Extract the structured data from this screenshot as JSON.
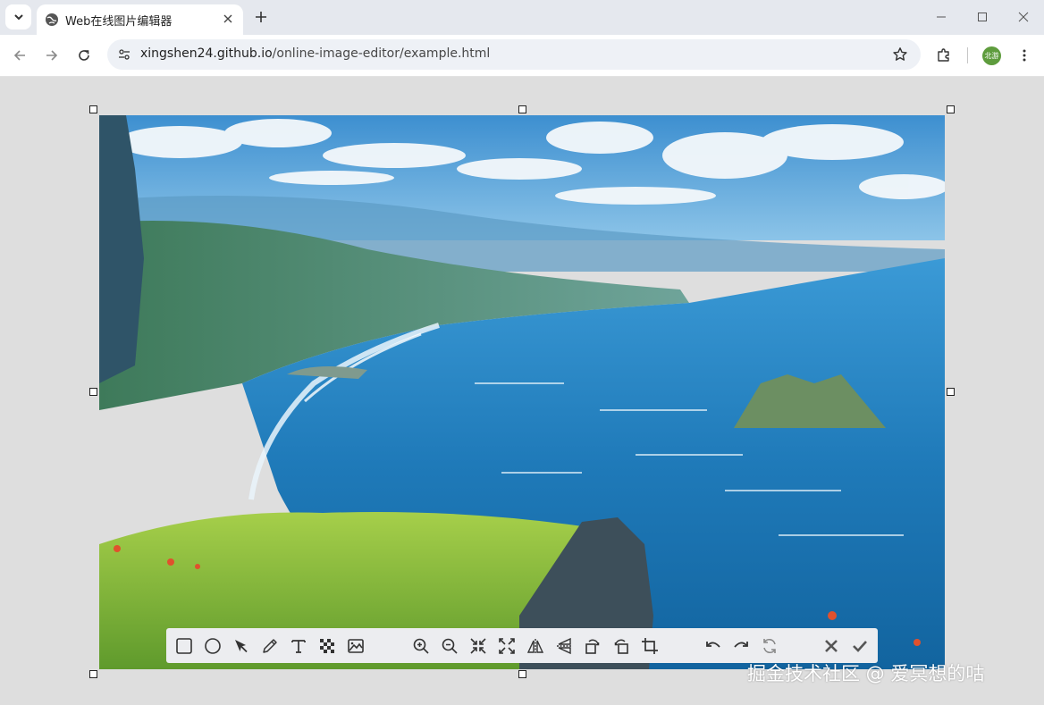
{
  "browser": {
    "tab_title": "Web在线图片编辑器",
    "url_host": "xingshen24.github.io",
    "url_path": "/online-image-editor/example.html",
    "profile_label": "北游"
  },
  "editor": {
    "tools_left": [
      "rectangle-icon",
      "ellipse-icon",
      "arrow-icon",
      "pencil-icon",
      "text-icon",
      "mosaic-icon",
      "image-icon"
    ],
    "tools_view": [
      "zoom-in-icon",
      "zoom-out-icon",
      "shrink-icon",
      "expand-icon",
      "flip-horizontal-icon",
      "flip-vertical-icon",
      "rotate-left-icon",
      "rotate-right-icon",
      "crop-icon"
    ],
    "tools_history": [
      "undo-icon",
      "redo-icon",
      "reset-icon"
    ],
    "tools_actions": [
      "cancel-icon",
      "confirm-icon"
    ]
  },
  "watermark": "掘金技术社区 @ 爱冥想的咕",
  "colors": {
    "sky": "#5aa7dc",
    "sea": "#1f79b8",
    "grass": "#7cb342",
    "toolbar_bg": "#ecedf0"
  }
}
